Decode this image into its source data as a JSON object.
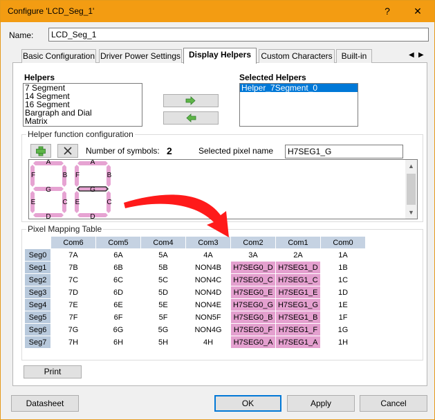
{
  "window": {
    "title": "Configure 'LCD_Seg_1'",
    "help_glyph": "?",
    "close_glyph": "✕"
  },
  "name": {
    "label": "Name:",
    "value": "LCD_Seg_1"
  },
  "tabs": [
    {
      "label": "Basic Configuration"
    },
    {
      "label": "Driver Power Settings"
    },
    {
      "label": "Display Helpers"
    },
    {
      "label": "Custom Characters"
    },
    {
      "label": "Built-in"
    }
  ],
  "tab_nav": {
    "prev": "◀",
    "next": "▶"
  },
  "helpers": {
    "title": "Helpers",
    "items": [
      "7 Segment",
      "14 Segment",
      "16 Segment",
      "Bargraph and Dial",
      "Matrix"
    ]
  },
  "selected_helpers": {
    "title": "Selected Helpers",
    "items": [
      "Helper_7Segment_0"
    ]
  },
  "helper_config": {
    "title": "Helper function configuration",
    "num_symbols_label": "Number of symbols:",
    "num_symbols_value": "2",
    "selected_pixel_label": "Selected pixel name",
    "selected_pixel_value": "H7SEG1_G"
  },
  "segment_labels": [
    "A",
    "B",
    "C",
    "D",
    "E",
    "F",
    "G"
  ],
  "pixel_table": {
    "title": "Pixel Mapping Table",
    "columns": [
      "Com6",
      "Com5",
      "Com4",
      "Com3",
      "Com2",
      "Com1",
      "Com0"
    ],
    "rows": [
      {
        "seg": "Seg0",
        "cells": [
          "7A",
          "6A",
          "5A",
          "4A",
          "3A",
          "2A",
          "1A"
        ]
      },
      {
        "seg": "Seg1",
        "cells": [
          "7B",
          "6B",
          "5B",
          "NON4B",
          "H7SEG0_D",
          "H7SEG1_D",
          "1B"
        ]
      },
      {
        "seg": "Seg2",
        "cells": [
          "7C",
          "6C",
          "5C",
          "NON4C",
          "H7SEG0_C",
          "H7SEG1_C",
          "1C"
        ]
      },
      {
        "seg": "Seg3",
        "cells": [
          "7D",
          "6D",
          "5D",
          "NON4D",
          "H7SEG0_E",
          "H7SEG1_E",
          "1D"
        ]
      },
      {
        "seg": "Seg4",
        "cells": [
          "7E",
          "6E",
          "5E",
          "NON4E",
          "H7SEG0_G",
          "H7SEG1_G",
          "1E"
        ]
      },
      {
        "seg": "Seg5",
        "cells": [
          "7F",
          "6F",
          "5F",
          "NON5F",
          "H7SEG0_B",
          "H7SEG1_B",
          "1F"
        ]
      },
      {
        "seg": "Seg6",
        "cells": [
          "7G",
          "6G",
          "5G",
          "NON4G",
          "H7SEG0_F",
          "H7SEG1_F",
          "1G"
        ]
      },
      {
        "seg": "Seg7",
        "cells": [
          "7H",
          "6H",
          "5H",
          "4H",
          "H7SEG0_A",
          "H7SEG1_A",
          "1H"
        ]
      }
    ]
  },
  "buttons": {
    "print": "Print",
    "datasheet": "Datasheet",
    "ok": "OK",
    "apply": "Apply",
    "cancel": "Cancel"
  },
  "colors": {
    "titlebar": "#f39c12",
    "segment_fill": "#e6a3d2",
    "mapped_cell": "#e4a0cf",
    "header_cell": "#c5d2e2",
    "selection": "#0078d7",
    "annotation_arrow": "#ff0000"
  },
  "icons": {
    "add": "plus-icon",
    "delete": "x-icon",
    "add_helper": "right-arrow-icon",
    "remove_helper": "left-arrow-icon"
  }
}
